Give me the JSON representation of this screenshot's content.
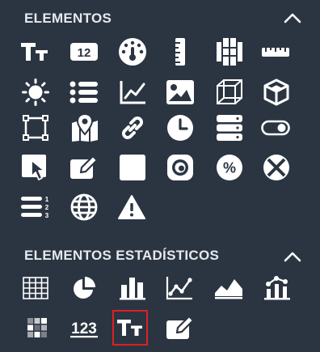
{
  "sections": [
    {
      "title": "ELEMENTOS",
      "expanded": true,
      "items": [
        "text-icon",
        "number-box-icon",
        "gauge-icon",
        "ruler-vertical-icon",
        "columns-icon",
        "ruler-horizontal-icon",
        "sun-icon",
        "list-icon",
        "line-chart-icon",
        "image-icon",
        "cube-wire-icon",
        "cube-icon",
        "crop-frame-icon",
        "map-icon",
        "link-icon",
        "clock-icon",
        "database-icon",
        "toggle-icon",
        "pointer-box-icon",
        "edit-icon",
        "square-icon",
        "webcam-icon",
        "percent-icon",
        "close-circle-icon",
        "numbered-list-icon",
        "globe-icon",
        "warning-icon"
      ]
    },
    {
      "title": "ELEMENTOS ESTADÍSTICOS",
      "expanded": true,
      "items": [
        "table-icon",
        "pie-chart-icon",
        "bar-chart-icon",
        "line-chart-points-icon",
        "area-chart-icon",
        "bar-line-chart-icon",
        "heatmap-icon",
        "number-123-icon",
        "text-icon",
        "edit-icon"
      ]
    }
  ],
  "icon_labels": {
    "number_box": "12",
    "numbers_123": "123",
    "numbered_list": [
      "1",
      "2",
      "3"
    ],
    "percent": "%"
  },
  "selected": {
    "section": 1,
    "item": 8
  },
  "colors": {
    "background": "#2b3542",
    "foreground": "#ffffff",
    "selection": "#e02020"
  }
}
